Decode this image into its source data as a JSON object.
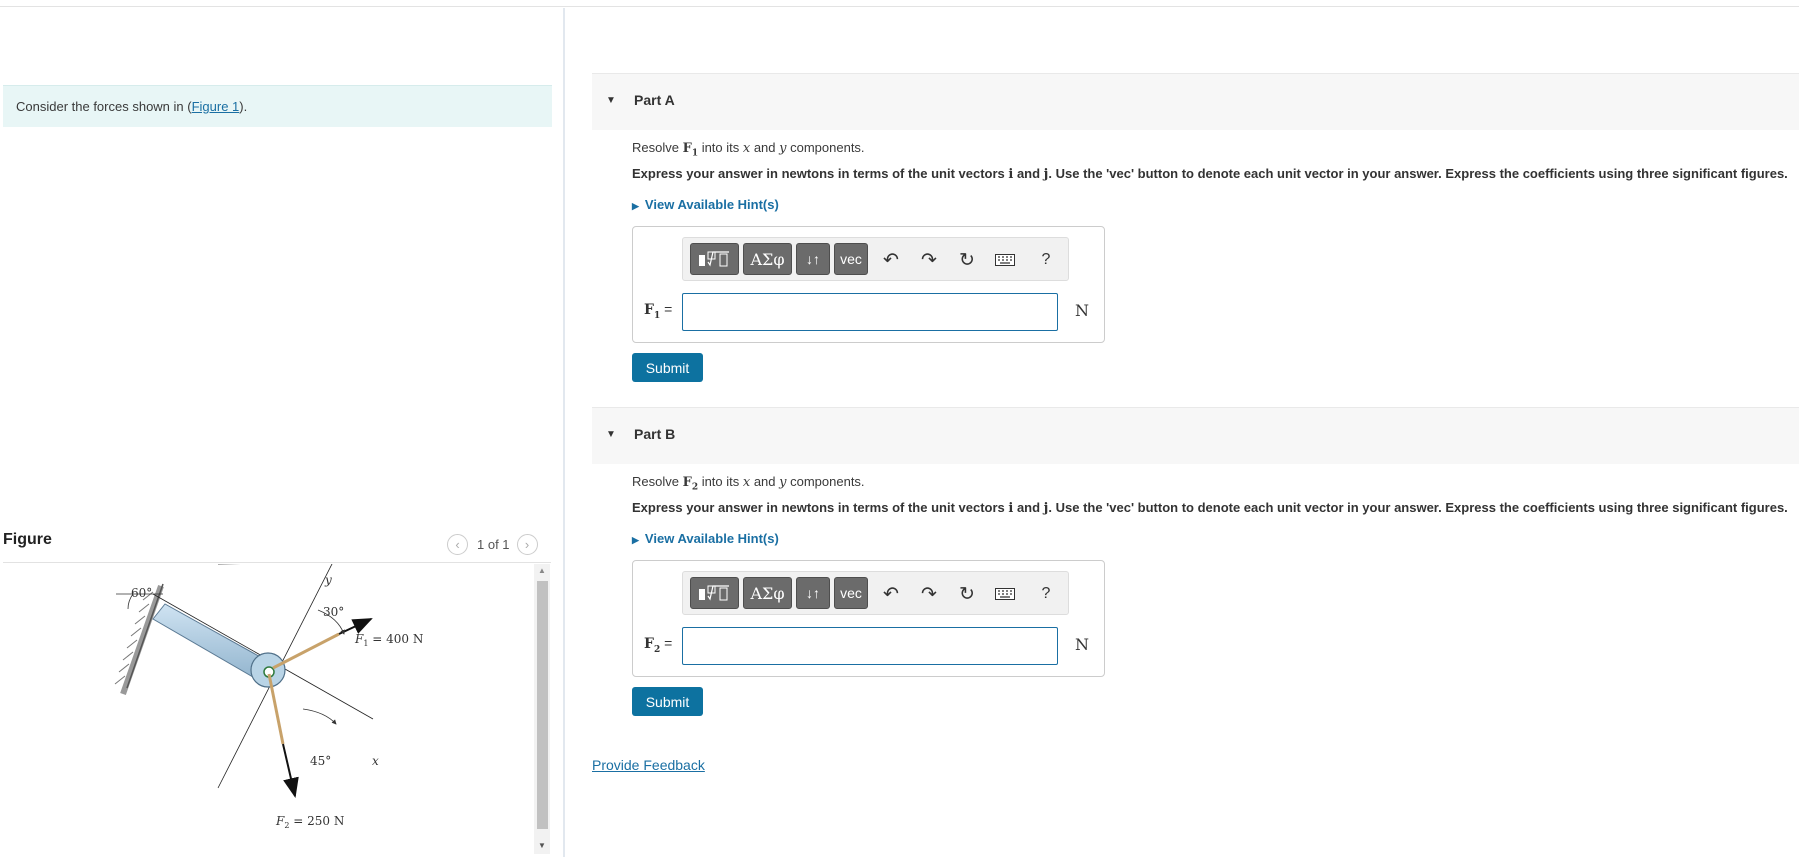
{
  "intro": {
    "prefix": "Consider the forces shown in (",
    "link": "Figure 1",
    "suffix": ")."
  },
  "figure": {
    "title": "Figure",
    "pager": {
      "prev_icon": "chevron-left-icon",
      "count": "1 of 1",
      "next_icon": "chevron-right-icon"
    },
    "labels": {
      "angle_wall": "60°",
      "axis_y": "y",
      "angle_f1": "30°",
      "f1_sym": "F",
      "f1_sub": "1",
      "f1_eq": " = 400 N",
      "angle_x": "45°",
      "axis_x": "x",
      "f2_sym": "F",
      "f2_sub": "2",
      "f2_eq": " = 250 N"
    }
  },
  "parts": [
    {
      "title": "Part A",
      "resolve": {
        "a": "Resolve ",
        "vec": "F",
        "sub": "1",
        "b": " into its ",
        "x": "x",
        "c": " and ",
        "y": "y",
        "d": " components."
      },
      "express": {
        "a": "Express your answer in newtons in terms of the unit vectors ",
        "i": "i",
        "and": " and ",
        "j": "j",
        "b": ". Use the 'vec' button to denote each unit vector in your answer. Express the coefficients using three significant figures."
      },
      "hint": "View Available Hint(s)",
      "field": {
        "sym": "F",
        "sub": "1",
        "eq": " =",
        "value": ""
      },
      "unit": "N",
      "submit": "Submit"
    },
    {
      "title": "Part B",
      "resolve": {
        "a": "Resolve ",
        "vec": "F",
        "sub": "2",
        "b": " into its ",
        "x": "x",
        "c": " and ",
        "y": "y",
        "d": " components."
      },
      "express": {
        "a": "Express your answer in newtons in terms of the unit vectors ",
        "i": "i",
        "and": " and ",
        "j": "j",
        "b": ". Use the 'vec' button to denote each unit vector in your answer. Express the coefficients using three significant figures."
      },
      "hint": "View Available Hint(s)",
      "field": {
        "sym": "F",
        "sub": "2",
        "eq": " =",
        "value": ""
      },
      "unit": "N",
      "submit": "Submit"
    }
  ],
  "toolbar": {
    "greek": "ΑΣφ",
    "arrows": "↓↑",
    "vec": "vec",
    "help": "?"
  },
  "feedback": "Provide Feedback",
  "colors": {
    "accent": "#0d72a0",
    "link": "#1a6fa3",
    "intro_bg": "#e8f6f6",
    "part_bg": "#f7f7f7",
    "toolbar_btn": "#6b6b6b"
  }
}
